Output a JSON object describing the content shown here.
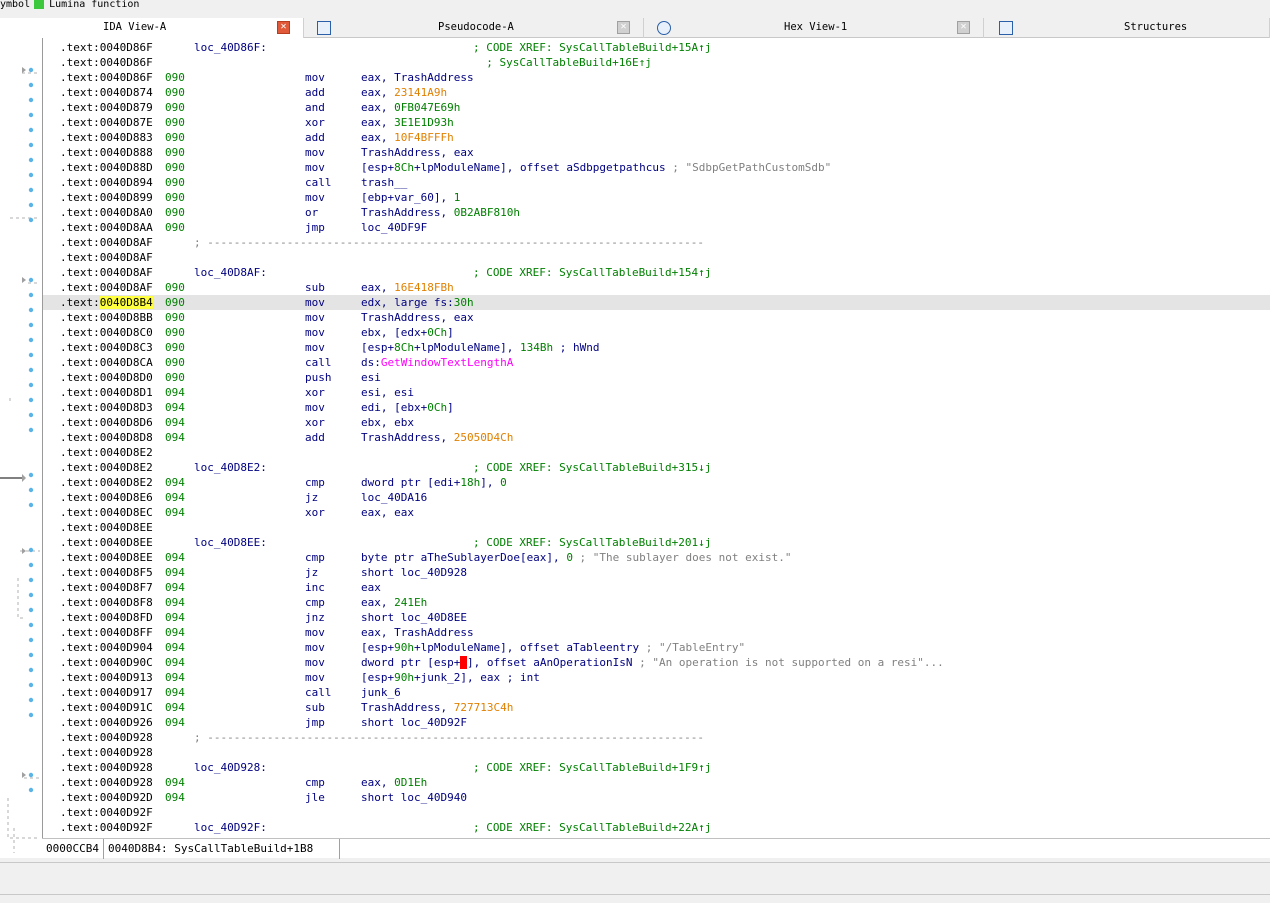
{
  "legend": {
    "items": [
      {
        "text": "ymbol",
        "color": null
      },
      {
        "text": "Lumina function",
        "color": "#3cc83c"
      }
    ]
  },
  "tabs": [
    {
      "label": "IDA View-A",
      "active": true,
      "icon": "close-icon"
    },
    {
      "label": "Pseudocode-A",
      "active": false,
      "icon": "pseudocode-icon"
    },
    {
      "label": "Hex View-1",
      "active": false,
      "icon": "hex-view-icon"
    },
    {
      "label": "Structures",
      "active": false,
      "icon": "structures-icon"
    }
  ],
  "code_lines": [
    {
      "addr": ".text:0040D86F",
      "sp": "",
      "label": "loc_40D86F:",
      "mn": "",
      "ops": [],
      "cm": [
        {
          "t": "; CODE XREF: SysCallTableBuild+15A↑j",
          "c": "cmt"
        }
      ]
    },
    {
      "addr": ".text:0040D86F",
      "sp": "",
      "label": "",
      "mn": "",
      "ops": [],
      "cm": [
        {
          "t": "  ; SysCallTableBuild+16E↑j",
          "c": "cmt"
        }
      ]
    },
    {
      "addr": ".text:0040D86F",
      "sp": "090",
      "label": "",
      "mn": "mov",
      "ops": [
        {
          "t": "eax, ",
          "c": "name"
        },
        {
          "t": "TrashAddress",
          "c": "name"
        }
      ],
      "cm": []
    },
    {
      "addr": ".text:0040D874",
      "sp": "090",
      "label": "",
      "mn": "add",
      "ops": [
        {
          "t": "eax, ",
          "c": "name"
        },
        {
          "t": "23141A9h",
          "c": "imm"
        }
      ],
      "cm": []
    },
    {
      "addr": ".text:0040D879",
      "sp": "090",
      "label": "",
      "mn": "and",
      "ops": [
        {
          "t": "eax, ",
          "c": "name"
        },
        {
          "t": "0FB047E69h",
          "c": "num"
        }
      ],
      "cm": []
    },
    {
      "addr": ".text:0040D87E",
      "sp": "090",
      "label": "",
      "mn": "xor",
      "ops": [
        {
          "t": "eax, ",
          "c": "name"
        },
        {
          "t": "3E1E1D93h",
          "c": "num"
        }
      ],
      "cm": []
    },
    {
      "addr": ".text:0040D883",
      "sp": "090",
      "label": "",
      "mn": "add",
      "ops": [
        {
          "t": "eax, ",
          "c": "name"
        },
        {
          "t": "10F4BFFFh",
          "c": "imm"
        }
      ],
      "cm": []
    },
    {
      "addr": ".text:0040D888",
      "sp": "090",
      "label": "",
      "mn": "mov",
      "ops": [
        {
          "t": "TrashAddress, eax",
          "c": "name"
        }
      ],
      "cm": []
    },
    {
      "addr": ".text:0040D88D",
      "sp": "090",
      "label": "",
      "mn": "mov",
      "ops": [
        {
          "t": "[esp+",
          "c": "name"
        },
        {
          "t": "8Ch",
          "c": "num"
        },
        {
          "t": "+lpModuleName], offset aSdbpgetpathcus ",
          "c": "name"
        },
        {
          "t": "; \"SdbpGetPathCustomSdb\"",
          "c": "str"
        }
      ],
      "cm": []
    },
    {
      "addr": ".text:0040D894",
      "sp": "090",
      "label": "",
      "mn": "call",
      "ops": [
        {
          "t": "trash__",
          "c": "name"
        }
      ],
      "cm": []
    },
    {
      "addr": ".text:0040D899",
      "sp": "090",
      "label": "",
      "mn": "mov",
      "ops": [
        {
          "t": "[ebp+var_60], ",
          "c": "name"
        },
        {
          "t": "1",
          "c": "num"
        }
      ],
      "cm": []
    },
    {
      "addr": ".text:0040D8A0",
      "sp": "090",
      "label": "",
      "mn": "or",
      "ops": [
        {
          "t": "TrashAddress, ",
          "c": "name"
        },
        {
          "t": "0B2ABF810h",
          "c": "num"
        }
      ],
      "cm": []
    },
    {
      "addr": ".text:0040D8AA",
      "sp": "090",
      "label": "",
      "mn": "jmp",
      "ops": [
        {
          "t": "loc_40DF9F",
          "c": "name"
        }
      ],
      "cm": []
    },
    {
      "addr": ".text:0040D8AF",
      "sp": "",
      "label": "",
      "mn": "",
      "ops": [],
      "cm": [],
      "sep": "; ---------------------------------------------------------------------------"
    },
    {
      "addr": ".text:0040D8AF",
      "sp": "",
      "label": "",
      "mn": "",
      "ops": [],
      "cm": []
    },
    {
      "addr": ".text:0040D8AF",
      "sp": "",
      "label": "loc_40D8AF:",
      "mn": "",
      "ops": [],
      "cm": [
        {
          "t": "; CODE XREF: SysCallTableBuild+154↑j",
          "c": "cmt"
        }
      ]
    },
    {
      "addr": ".text:0040D8AF",
      "sp": "090",
      "label": "",
      "mn": "sub",
      "ops": [
        {
          "t": "eax, ",
          "c": "name"
        },
        {
          "t": "16E418FBh",
          "c": "imm"
        }
      ],
      "cm": []
    },
    {
      "addr": ".text:0040D8B4",
      "sp": "090",
      "label": "",
      "mn": "mov",
      "ops": [
        {
          "t": "edx, large fs:",
          "c": "name"
        },
        {
          "t": "30h",
          "c": "num"
        }
      ],
      "cm": [],
      "hl": true
    },
    {
      "addr": ".text:0040D8BB",
      "sp": "090",
      "label": "",
      "mn": "mov",
      "ops": [
        {
          "t": "TrashAddress, eax",
          "c": "name"
        }
      ],
      "cm": []
    },
    {
      "addr": ".text:0040D8C0",
      "sp": "090",
      "label": "",
      "mn": "mov",
      "ops": [
        {
          "t": "ebx, [edx+",
          "c": "name"
        },
        {
          "t": "0Ch",
          "c": "num"
        },
        {
          "t": "]",
          "c": "name"
        }
      ],
      "cm": []
    },
    {
      "addr": ".text:0040D8C3",
      "sp": "090",
      "label": "",
      "mn": "mov",
      "ops": [
        {
          "t": "[esp+",
          "c": "name"
        },
        {
          "t": "8Ch",
          "c": "num"
        },
        {
          "t": "+lpModuleName], ",
          "c": "name"
        },
        {
          "t": "134Bh",
          "c": "num"
        },
        {
          "t": " ; hWnd",
          "c": "name"
        }
      ],
      "cm": []
    },
    {
      "addr": ".text:0040D8CA",
      "sp": "090",
      "label": "",
      "mn": "call",
      "ops": [
        {
          "t": "ds:",
          "c": "name"
        },
        {
          "t": "GetWindowTextLengthA",
          "c": "imp"
        }
      ],
      "cm": []
    },
    {
      "addr": ".text:0040D8D0",
      "sp": "090",
      "label": "",
      "mn": "push",
      "ops": [
        {
          "t": "esi",
          "c": "name"
        }
      ],
      "cm": []
    },
    {
      "addr": ".text:0040D8D1",
      "sp": "094",
      "label": "",
      "mn": "xor",
      "ops": [
        {
          "t": "esi, esi",
          "c": "name"
        }
      ],
      "cm": []
    },
    {
      "addr": ".text:0040D8D3",
      "sp": "094",
      "label": "",
      "mn": "mov",
      "ops": [
        {
          "t": "edi, [ebx+",
          "c": "name"
        },
        {
          "t": "0Ch",
          "c": "num"
        },
        {
          "t": "]",
          "c": "name"
        }
      ],
      "cm": []
    },
    {
      "addr": ".text:0040D8D6",
      "sp": "094",
      "label": "",
      "mn": "xor",
      "ops": [
        {
          "t": "ebx, ebx",
          "c": "name"
        }
      ],
      "cm": []
    },
    {
      "addr": ".text:0040D8D8",
      "sp": "094",
      "label": "",
      "mn": "add",
      "ops": [
        {
          "t": "TrashAddress, ",
          "c": "name"
        },
        {
          "t": "25050D4Ch",
          "c": "imm"
        }
      ],
      "cm": []
    },
    {
      "addr": ".text:0040D8E2",
      "sp": "",
      "label": "",
      "mn": "",
      "ops": [],
      "cm": []
    },
    {
      "addr": ".text:0040D8E2",
      "sp": "",
      "label": "loc_40D8E2:",
      "mn": "",
      "ops": [],
      "cm": [
        {
          "t": "; CODE XREF: SysCallTableBuild+315↓j",
          "c": "cmt"
        }
      ]
    },
    {
      "addr": ".text:0040D8E2",
      "sp": "094",
      "label": "",
      "mn": "cmp",
      "ops": [
        {
          "t": "dword ptr [edi+",
          "c": "name"
        },
        {
          "t": "18h",
          "c": "num"
        },
        {
          "t": "], ",
          "c": "name"
        },
        {
          "t": "0",
          "c": "num"
        }
      ],
      "cm": []
    },
    {
      "addr": ".text:0040D8E6",
      "sp": "094",
      "label": "",
      "mn": "jz",
      "ops": [
        {
          "t": "loc_40DA16",
          "c": "name"
        }
      ],
      "cm": []
    },
    {
      "addr": ".text:0040D8EC",
      "sp": "094",
      "label": "",
      "mn": "xor",
      "ops": [
        {
          "t": "eax, eax",
          "c": "name"
        }
      ],
      "cm": []
    },
    {
      "addr": ".text:0040D8EE",
      "sp": "",
      "label": "",
      "mn": "",
      "ops": [],
      "cm": []
    },
    {
      "addr": ".text:0040D8EE",
      "sp": "",
      "label": "loc_40D8EE:",
      "mn": "",
      "ops": [],
      "cm": [
        {
          "t": "; CODE XREF: SysCallTableBuild+201↓j",
          "c": "cmt"
        }
      ]
    },
    {
      "addr": ".text:0040D8EE",
      "sp": "094",
      "label": "",
      "mn": "cmp",
      "ops": [
        {
          "t": "byte ptr aTheSublayerDoe[eax], ",
          "c": "name"
        },
        {
          "t": "0",
          "c": "num"
        },
        {
          "t": " ; \"The sublayer does not exist.\"",
          "c": "str"
        }
      ],
      "cm": []
    },
    {
      "addr": ".text:0040D8F5",
      "sp": "094",
      "label": "",
      "mn": "jz",
      "ops": [
        {
          "t": "short loc_40D928",
          "c": "name"
        }
      ],
      "cm": []
    },
    {
      "addr": ".text:0040D8F7",
      "sp": "094",
      "label": "",
      "mn": "inc",
      "ops": [
        {
          "t": "eax",
          "c": "name"
        }
      ],
      "cm": []
    },
    {
      "addr": ".text:0040D8F8",
      "sp": "094",
      "label": "",
      "mn": "cmp",
      "ops": [
        {
          "t": "eax, ",
          "c": "name"
        },
        {
          "t": "241Eh",
          "c": "num"
        }
      ],
      "cm": []
    },
    {
      "addr": ".text:0040D8FD",
      "sp": "094",
      "label": "",
      "mn": "jnz",
      "ops": [
        {
          "t": "short loc_40D8EE",
          "c": "name"
        }
      ],
      "cm": []
    },
    {
      "addr": ".text:0040D8FF",
      "sp": "094",
      "label": "",
      "mn": "mov",
      "ops": [
        {
          "t": "eax, TrashAddress",
          "c": "name"
        }
      ],
      "cm": []
    },
    {
      "addr": ".text:0040D904",
      "sp": "094",
      "label": "",
      "mn": "mov",
      "ops": [
        {
          "t": "[esp+",
          "c": "name"
        },
        {
          "t": "90h",
          "c": "num"
        },
        {
          "t": "+lpModuleName], offset aTableentry ",
          "c": "name"
        },
        {
          "t": "; \"/TableEntry\"",
          "c": "str"
        }
      ],
      "cm": []
    },
    {
      "addr": ".text:0040D90C",
      "sp": "094",
      "label": "",
      "mn": "mov",
      "ops": [
        {
          "t": "dword ptr [esp+",
          "c": "name"
        },
        {
          "t": "8",
          "c": "red"
        },
        {
          "t": "], offset aAnOperationIsN ",
          "c": "name"
        },
        {
          "t": "; \"An operation is not supported on a resi\"...",
          "c": "str"
        }
      ],
      "cm": []
    },
    {
      "addr": ".text:0040D913",
      "sp": "094",
      "label": "",
      "mn": "mov",
      "ops": [
        {
          "t": "[esp+",
          "c": "name"
        },
        {
          "t": "90h",
          "c": "num"
        },
        {
          "t": "+junk_2], eax ; int",
          "c": "name"
        }
      ],
      "cm": []
    },
    {
      "addr": ".text:0040D917",
      "sp": "094",
      "label": "",
      "mn": "call",
      "ops": [
        {
          "t": "junk_6",
          "c": "name"
        }
      ],
      "cm": []
    },
    {
      "addr": ".text:0040D91C",
      "sp": "094",
      "label": "",
      "mn": "sub",
      "ops": [
        {
          "t": "TrashAddress, ",
          "c": "name"
        },
        {
          "t": "727713C4h",
          "c": "imm"
        }
      ],
      "cm": []
    },
    {
      "addr": ".text:0040D926",
      "sp": "094",
      "label": "",
      "mn": "jmp",
      "ops": [
        {
          "t": "short loc_40D92F",
          "c": "name"
        }
      ],
      "cm": []
    },
    {
      "addr": ".text:0040D928",
      "sp": "",
      "label": "",
      "mn": "",
      "ops": [],
      "cm": [],
      "sep": "; ---------------------------------------------------------------------------"
    },
    {
      "addr": ".text:0040D928",
      "sp": "",
      "label": "",
      "mn": "",
      "ops": [],
      "cm": []
    },
    {
      "addr": ".text:0040D928",
      "sp": "",
      "label": "loc_40D928:",
      "mn": "",
      "ops": [],
      "cm": [
        {
          "t": "; CODE XREF: SysCallTableBuild+1F9↑j",
          "c": "cmt"
        }
      ]
    },
    {
      "addr": ".text:0040D928",
      "sp": "094",
      "label": "",
      "mn": "cmp",
      "ops": [
        {
          "t": "eax, ",
          "c": "name"
        },
        {
          "t": "0D1Eh",
          "c": "num"
        }
      ],
      "cm": []
    },
    {
      "addr": ".text:0040D92D",
      "sp": "094",
      "label": "",
      "mn": "jle",
      "ops": [
        {
          "t": "short loc_40D940",
          "c": "name"
        }
      ],
      "cm": []
    },
    {
      "addr": ".text:0040D92F",
      "sp": "",
      "label": "",
      "mn": "",
      "ops": [],
      "cm": []
    },
    {
      "addr": ".text:0040D92F",
      "sp": "",
      "label": "loc_40D92F:",
      "mn": "",
      "ops": [],
      "cm": [
        {
          "t": "; CODE XREF: SysCallTableBuild+22A↑j",
          "c": "cmt"
        }
      ]
    }
  ],
  "status": {
    "offset": "0000CCB4",
    "location": "0040D8B4: SysCallTableBuild+1B8"
  },
  "colors": {
    "address": "#000000",
    "stack": "#008000",
    "instruction": "#000080",
    "immediate_orange": "#e08000",
    "string_comment": "#808080",
    "import": "#ff00ff",
    "highlight_row": "#e4e4e4",
    "cursor": "#ffff40"
  }
}
